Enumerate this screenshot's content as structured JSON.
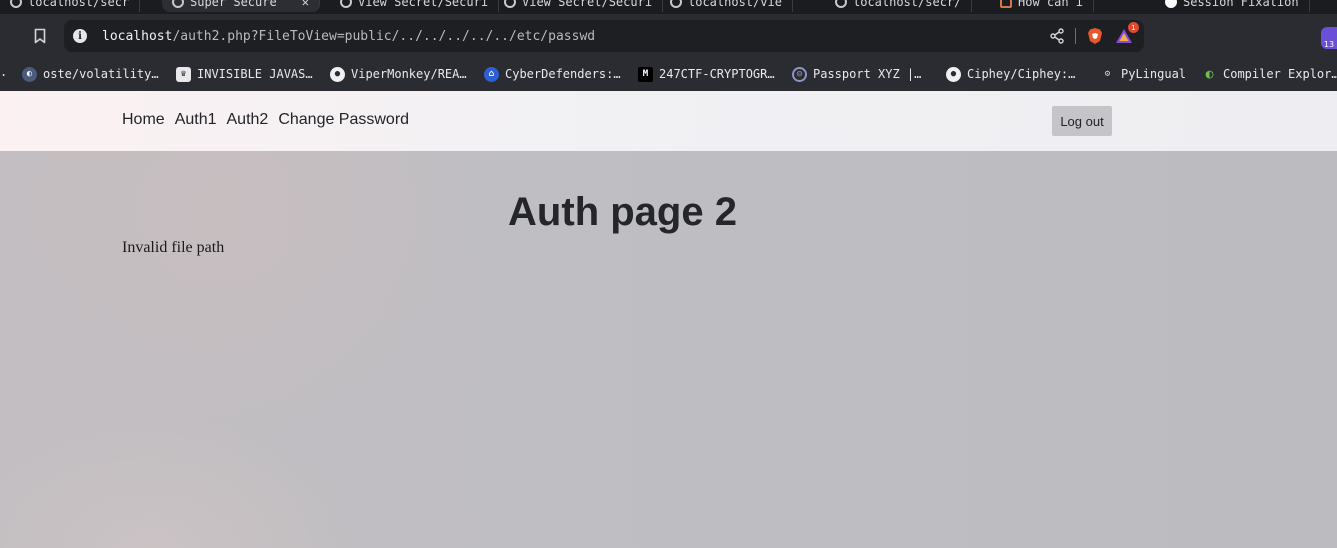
{
  "browser": {
    "tabs": [
      {
        "label": "localhost/secr"
      },
      {
        "label": "Super Secure",
        "active": true
      },
      {
        "label": "View Secret/Securi"
      },
      {
        "label": "View Secret/Securi"
      },
      {
        "label": "localhost/vie"
      },
      {
        "label": "localhost/secr/"
      },
      {
        "label": "How can i "
      },
      {
        "label": "Session Fixation"
      }
    ],
    "url": {
      "host": "localhost",
      "path": "/auth2.php?FileToView=public/../../../../../etc/passwd"
    },
    "rewards_badge": "1",
    "extension_badge": "13",
    "bookmarks_lead": ".",
    "bookmarks": [
      {
        "label": "oste/volatility…",
        "icon": "volatility-icon"
      },
      {
        "label": "INVISIBLE JAVAS…",
        "icon": "chef-hat-icon"
      },
      {
        "label": "ViperMonkey/REA…",
        "icon": "github-icon"
      },
      {
        "label": "CyberDefenders:…",
        "icon": "cyberdefenders-icon"
      },
      {
        "label": "247CTF-CRYPTOGR…",
        "icon": "medium-icon"
      },
      {
        "label": "Passport XYZ |…",
        "icon": "passport-icon"
      },
      {
        "label": "Ciphey/Ciphey:…",
        "icon": "github-icon"
      },
      {
        "label": "PyLingual",
        "icon": "pylingual-icon"
      },
      {
        "label": "Compiler Explor…",
        "icon": "compiler-explorer-icon"
      }
    ]
  },
  "page": {
    "nav": {
      "links": [
        "Home",
        "Auth1",
        "Auth2",
        "Change Password"
      ],
      "logout_label": "Log out"
    },
    "title": "Auth page 2",
    "message": "Invalid file path"
  },
  "colors": {
    "navbar_bg": "#f0f0f3",
    "page_bg": "#bdbdc1",
    "title": "#25262a",
    "logout_bg": "#c5c5c9",
    "chrome_bg": "#2b2c31"
  }
}
